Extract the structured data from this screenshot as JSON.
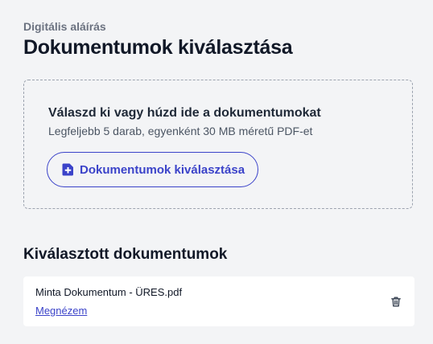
{
  "header": {
    "eyebrow": "Digitális aláírás",
    "title": "Dokumentumok kiválasztása"
  },
  "dropzone": {
    "title": "Válaszd ki vagy húzd ide a dokumentumokat",
    "subtitle": "Legfeljebb 5 darab, egyenként 30 MB méretű PDF-et",
    "button_label": "Dokumentumok kiválasztása",
    "button_icon": "file-plus-icon"
  },
  "selected": {
    "title": "Kiválasztott dokumentumok",
    "files": [
      {
        "name": "Minta Dokumentum - ÜRES.pdf",
        "view_label": "Megnézem",
        "delete_icon": "trash-icon"
      }
    ]
  },
  "colors": {
    "accent": "#3b43c9",
    "background": "#f3f4f6",
    "card": "#ffffff",
    "muted_text": "#6b7280"
  }
}
